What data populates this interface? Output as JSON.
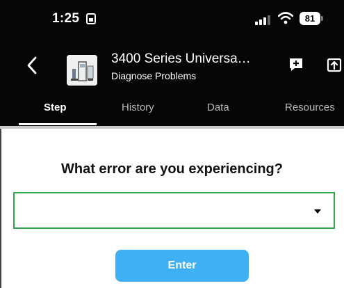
{
  "status_bar": {
    "time": "1:25",
    "battery": "81",
    "icons": [
      "sim-card-icon",
      "signal-icon",
      "wifi-icon",
      "battery-icon"
    ]
  },
  "app_bar": {
    "back_icon": "chevron-left-icon",
    "title": "3400 Series Universa…",
    "subtitle": "Diagnose Problems",
    "actions": [
      "add-note-icon",
      "share-icon"
    ]
  },
  "tabs": [
    {
      "label": "Step",
      "active": true
    },
    {
      "label": "History",
      "active": false
    },
    {
      "label": "Data",
      "active": false
    },
    {
      "label": "Resources",
      "active": false
    }
  ],
  "main": {
    "question": "What error are you experiencing?",
    "select": {
      "value": "",
      "accent_color": "#2aa84a"
    },
    "enter_label": "Enter",
    "enter_color": "#3fb0f3"
  }
}
